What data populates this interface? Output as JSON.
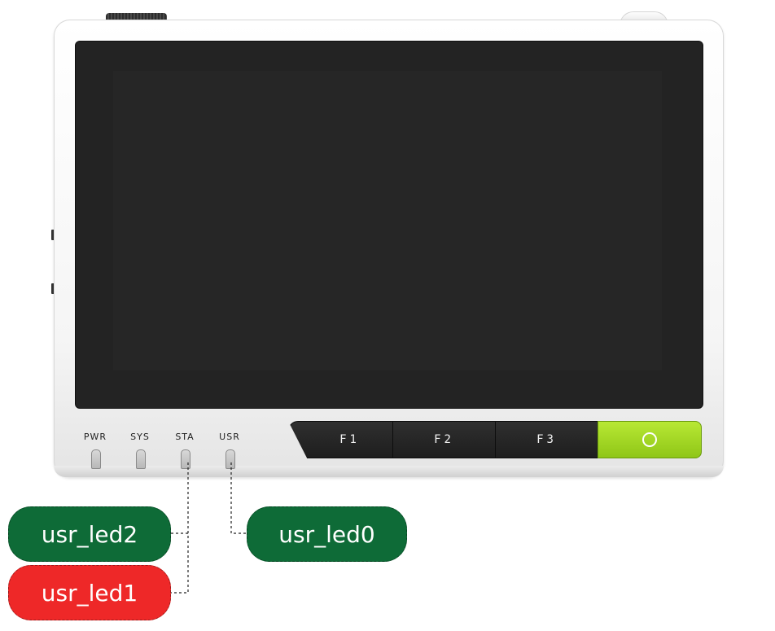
{
  "leds": [
    {
      "label": "PWR"
    },
    {
      "label": "SYS"
    },
    {
      "label": "STA"
    },
    {
      "label": "USR"
    }
  ],
  "buttons": [
    {
      "label": "F1"
    },
    {
      "label": "F2"
    },
    {
      "label": "F3"
    },
    {
      "label": "",
      "icon": "circle-icon",
      "color": "#a6db24"
    }
  ],
  "callouts": [
    {
      "text": "usr_led2",
      "color": "#0e6b37"
    },
    {
      "text": "usr_led0",
      "color": "#0e6b37"
    },
    {
      "text": "usr_led1",
      "color": "#ee2828"
    }
  ]
}
